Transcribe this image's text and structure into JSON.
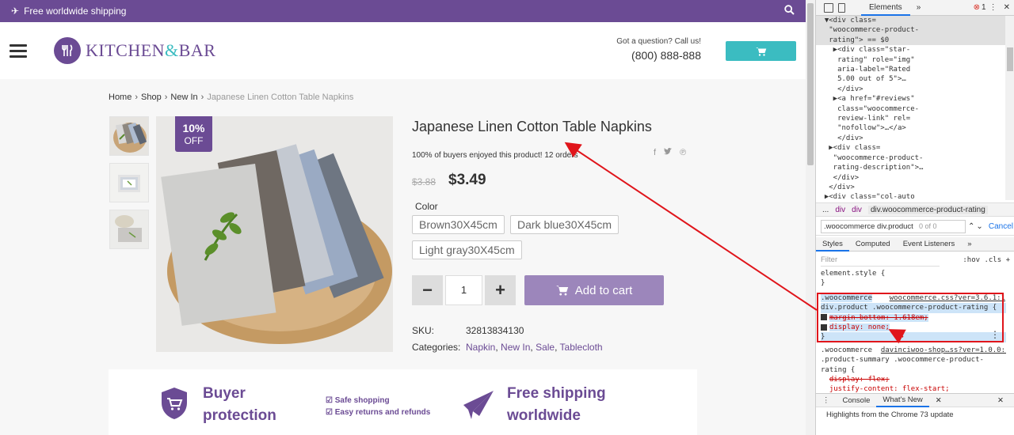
{
  "topbar": {
    "shipping_text": "Free worldwide shipping"
  },
  "header": {
    "logo_word1": "KITCHEN",
    "logo_amp": "&",
    "logo_word2": "BAR",
    "question": "Got a question? Call us!",
    "phone": "(800) 888-888"
  },
  "breadcrumb": {
    "home": "Home",
    "shop": "Shop",
    "new_in": "New In",
    "current": "Japanese Linen Cotton Table Napkins"
  },
  "product": {
    "badge_pct": "10%",
    "badge_off": "OFF",
    "title": "Japanese Linen Cotton Table Napkins",
    "buyers_text": "100% of buyers enjoyed this product! 12 orders",
    "old_price": "$3.88",
    "price": "$3.49",
    "color_label": "Color",
    "options": [
      "Brown30X45cm",
      "Dark blue30X45cm",
      "Light gray30X45cm"
    ],
    "qty_minus": "−",
    "qty_value": "1",
    "qty_plus": "+",
    "add_to_cart": "Add to cart",
    "sku_label": "SKU:",
    "sku_value": "32813834130",
    "categories_label": "Categories:",
    "categories": [
      "Napkin",
      "New In",
      "Sale",
      "Tablecloth"
    ],
    "category_sep": ", "
  },
  "features": {
    "buyer_title_1": "Buyer",
    "buyer_title_2": "protection",
    "list": [
      "Safe shopping",
      "Easy returns and refunds"
    ],
    "shipping_title_1": "Free shipping",
    "shipping_title_2": "worldwide"
  },
  "devtools": {
    "tab_elements": "Elements",
    "more": "»",
    "error_icon": "⊗",
    "error_count": "1",
    "kebab": "⋮",
    "close": "✕",
    "dom_lines": [
      {
        "text": "  ▼<div class=",
        "sel": true
      },
      {
        "text": "   \"woocommerce-product-",
        "sel": true
      },
      {
        "text": "   rating\"> == $0",
        "sel": true
      },
      {
        "text": "    ▶<div class=\"star-",
        "sel": false
      },
      {
        "text": "     rating\" role=\"img\"",
        "sel": false
      },
      {
        "text": "     aria-label=\"Rated",
        "sel": false
      },
      {
        "text": "     5.00 out of 5\">…",
        "sel": false
      },
      {
        "text": "     </div>",
        "sel": false
      },
      {
        "text": "    ▶<a href=\"#reviews\"",
        "sel": false
      },
      {
        "text": "     class=\"woocommerce-",
        "sel": false
      },
      {
        "text": "     review-link\" rel=",
        "sel": false
      },
      {
        "text": "     \"nofollow\">…</a>",
        "sel": false
      },
      {
        "text": "     </div>",
        "sel": false
      },
      {
        "text": "   ▶<div class=",
        "sel": false
      },
      {
        "text": "    \"woocommerce-product-",
        "sel": false
      },
      {
        "text": "    rating-description\">…",
        "sel": false
      },
      {
        "text": "    </div>",
        "sel": false
      },
      {
        "text": "   </div>",
        "sel": false
      },
      {
        "text": "  ▶<div class=\"col-auto",
        "sel": false
      }
    ],
    "crumbs_dots": "...",
    "crumb_1": "div",
    "crumb_2": "div",
    "crumb_3": "div.woocommerce-product-rating",
    "find_value": ".woocommerce div.product",
    "find_count": "0 of 0",
    "find_cancel": "Cancel",
    "subtab_styles": "Styles",
    "subtab_computed": "Computed",
    "subtab_listeners": "Event Listeners",
    "subtab_more": "»",
    "filter_placeholder": "Filter",
    "filter_hov": ":hov",
    "filter_cls": ".cls",
    "filter_plus": "+",
    "style_element": "element.style {",
    "style_close": "}",
    "rule1_selector_a": ".woocommerce",
    "rule1_source": "woocommerce.css?ver=3.6.1:1",
    "rule1_selector_b": "div.product .woocommerce-product-rating {",
    "rule1_prop1": "margin-bottom: 1.618em;",
    "rule1_prop2": "display: none;",
    "rule1_close": "}",
    "rule2_selector_a": ".woocommerce",
    "rule2_source": "davinciwoo-shop…ss?ver=1.0.0:1",
    "rule2_selector_b": ".product-summary .woocommerce-product-",
    "rule2_selector_c": "rating {",
    "rule2_prop1": "display: flex;",
    "rule2_prop2": "justify-content: flex-start;",
    "drawer_console": "Console",
    "drawer_whatsnew": "What's New",
    "drawer_close": "✕",
    "drawer_text": "Highlights from the Chrome 73 update"
  },
  "colors": {
    "brand_purple": "#6b4b94",
    "teal": "#3bbcc1",
    "annotation_red": "#e0151b"
  }
}
